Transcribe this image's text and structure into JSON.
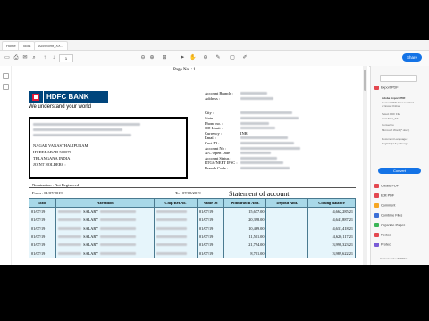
{
  "tabs": [
    "Home",
    "Tools",
    "Acct Stmt_XX..."
  ],
  "toolbar": {
    "page_current": "1",
    "share_label": "Share",
    "icons": [
      "save-icon",
      "print-icon",
      "mail-icon",
      "search-icon",
      "page-up-icon",
      "page-down-icon",
      "cursor-icon",
      "hand-icon",
      "zoom-out-icon",
      "zoom-in-icon",
      "fit-icon",
      "sign-icon",
      "comment-icon",
      "highlight-icon"
    ]
  },
  "statement": {
    "page_no": "Page No .:  1",
    "bank_name": "HDFC BANK",
    "tagline": "We understand your world",
    "address_lines": {
      "city": "NAGAR VANASTHALIPURAM",
      "city2": "HYDERABAD 500070",
      "state": "TELANGANA INDIA",
      "joint": "JOINT HOLDERS :"
    },
    "right_labels": [
      "Account Branch :",
      "Address :",
      "",
      "",
      "City :",
      "State :",
      "Phone no. :",
      "OD Limit :",
      "Currency :",
      "Email :",
      "Cust ID :",
      "Account No :",
      "A/C Open Date :",
      "Account Status :",
      "RTGS/NEFT IFSC :",
      "Branch Code :"
    ],
    "right_values": [
      "",
      "",
      "",
      "",
      "",
      "",
      "",
      "",
      "INR",
      "",
      "",
      "",
      "",
      "",
      "",
      ""
    ],
    "nomination": "Nomination :  Not Registered",
    "from": "From :  01/07/2019",
    "to": "To :  07/08/2019",
    "title": "Statement of account",
    "headers": [
      "Date",
      "Narration",
      "Chq./Ref.No.",
      "Value Dt",
      "Withdrawal Amt.",
      "Deposit Amt.",
      "Closing Balance"
    ],
    "rows": [
      {
        "date": "01/07/19",
        "narr": "SALARY",
        "chq": "",
        "val": "01/07/19",
        "wd": "15,677.00",
        "dep": "",
        "bal": "4,662,285.21"
      },
      {
        "date": "01/07/19",
        "narr": "SALARY",
        "chq": "",
        "val": "01/07/19",
        "wd": "20,398.00",
        "dep": "",
        "bal": "4,641,887.21"
      },
      {
        "date": "01/07/19",
        "narr": "SALARY",
        "chq": "",
        "val": "01/07/19",
        "wd": "10,469.00",
        "dep": "",
        "bal": "4,631,418.21"
      },
      {
        "date": "01/07/19",
        "narr": "SALARY",
        "chq": "",
        "val": "01/07/19",
        "wd": "11,501.00",
        "dep": "",
        "bal": "4,620,117.21"
      },
      {
        "date": "01/07/19",
        "narr": "SALARY",
        "chq": "",
        "val": "01/07/19",
        "wd": "21,794.00",
        "dep": "",
        "bal": "3,998,323.21"
      },
      {
        "date": "01/07/19",
        "narr": "SALARY",
        "chq": "",
        "val": "01/07/19",
        "wd": "8,701.00",
        "dep": "",
        "bal": "3,989,622.21"
      }
    ]
  },
  "right_panel": {
    "search_placeholder": "",
    "export_pdf": "Export PDF",
    "export_desc1": "Adobe Export PDF",
    "export_desc2": "Convert PDF Files to Word",
    "export_desc3": "or Excel Online",
    "select_label": "Select PDF File",
    "file_name": "Acct Stmt_XX...",
    "convert_to": "Convert to",
    "format": "Microsoft Word (*.docx)",
    "doc_lang": "Document Language:",
    "lang": "English (U.S.) Change",
    "convert_btn": "Convert",
    "tools": [
      "Create PDF",
      "Edit PDF",
      "Comment",
      "Combine Files",
      "Organize Pages",
      "Redact",
      "Protect"
    ],
    "tool_colors": [
      "#e34850",
      "#e34850",
      "#f5a623",
      "#3c6fd6",
      "#3ab557",
      "#e34850",
      "#7a5cd6"
    ],
    "footer": "Convert and edit PDFs"
  }
}
